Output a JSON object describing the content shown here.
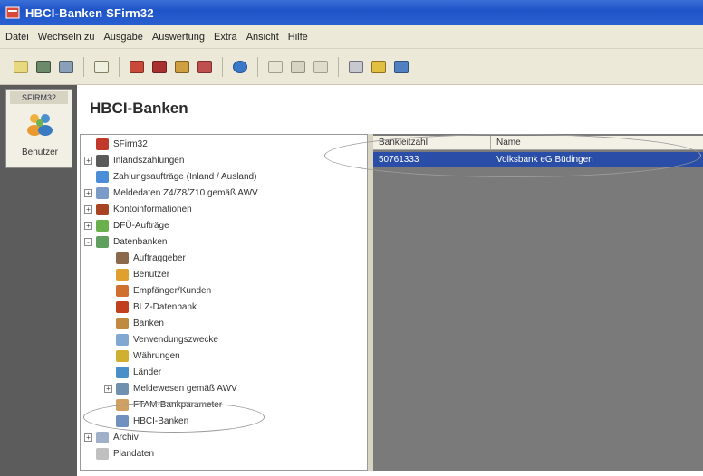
{
  "window": {
    "title": "HBCI-Banken   SFirm32"
  },
  "menu": [
    "Datei",
    "Wechseln zu",
    "Ausgabe",
    "Auswertung",
    "Extra",
    "Ansicht",
    "Hilfe"
  ],
  "toolbar": {
    "icons": [
      "note-icon",
      "grid-icon",
      "table-icon",
      "document-icon",
      "transfer-icon",
      "red-book-icon",
      "card-icon",
      "letter-icon",
      "ie-icon",
      "cut-icon",
      "copy-icon",
      "paste-icon",
      "print-icon",
      "help-icon",
      "question-icon"
    ]
  },
  "leftbar": {
    "app_label": "SFIRM32",
    "benutzer_label": "Benutzer"
  },
  "header": {
    "title": "HBCI-Banken"
  },
  "tree": [
    {
      "label": "SFirm32",
      "expander": "",
      "icon_color": "#c0392b",
      "indent": 0
    },
    {
      "label": "Inlandszahlungen",
      "expander": "+",
      "icon_color": "#5a5a5a",
      "indent": 0
    },
    {
      "label": "Zahlungsaufträge (Inland / Ausland)",
      "expander": "",
      "icon_color": "#4a8ed8",
      "indent": 0
    },
    {
      "label": "Meldedaten Z4/Z8/Z10 gemäß AWV",
      "expander": "+",
      "icon_color": "#7a9ac8",
      "indent": 0
    },
    {
      "label": "Kontoinformationen",
      "expander": "+",
      "icon_color": "#a94422",
      "indent": 0
    },
    {
      "label": "DFÜ-Aufträge",
      "expander": "+",
      "icon_color": "#6ab04c",
      "indent": 0
    },
    {
      "label": "Datenbanken",
      "expander": "-",
      "icon_color": "#5fa05f",
      "indent": 0
    },
    {
      "label": "Auftraggeber",
      "expander": "",
      "icon_color": "#8a6a4a",
      "indent": 1
    },
    {
      "label": "Benutzer",
      "expander": "",
      "icon_color": "#e0a030",
      "indent": 1
    },
    {
      "label": "Empfänger/Kunden",
      "expander": "",
      "icon_color": "#d07030",
      "indent": 1
    },
    {
      "label": "BLZ-Datenbank",
      "expander": "",
      "icon_color": "#c04020",
      "indent": 1
    },
    {
      "label": "Banken",
      "expander": "",
      "icon_color": "#c08a40",
      "indent": 1
    },
    {
      "label": "Verwendungszwecke",
      "expander": "",
      "icon_color": "#80a8d0",
      "indent": 1
    },
    {
      "label": "Währungen",
      "expander": "",
      "icon_color": "#d0b030",
      "indent": 1
    },
    {
      "label": "Länder",
      "expander": "",
      "icon_color": "#4a90c8",
      "indent": 1
    },
    {
      "label": "Meldewesen gemäß AWV",
      "expander": "+",
      "icon_color": "#7090b0",
      "indent": 1
    },
    {
      "label": "FTAM-Bankparameter",
      "expander": "",
      "icon_color": "#d0a060",
      "indent": 1
    },
    {
      "label": "HBCI-Banken",
      "expander": "",
      "icon_color": "#7090c0",
      "indent": 1
    },
    {
      "label": "Archiv",
      "expander": "+",
      "icon_color": "#a0b0c8",
      "indent": 0
    },
    {
      "label": "Plandaten",
      "expander": "",
      "icon_color": "#c0c0c0",
      "indent": 0
    }
  ],
  "list": {
    "columns": [
      "Bankleitzahl",
      "Name"
    ],
    "rows": [
      {
        "blz": "50761333",
        "name": "Volksbank eG Büdingen",
        "selected": true
      }
    ]
  }
}
